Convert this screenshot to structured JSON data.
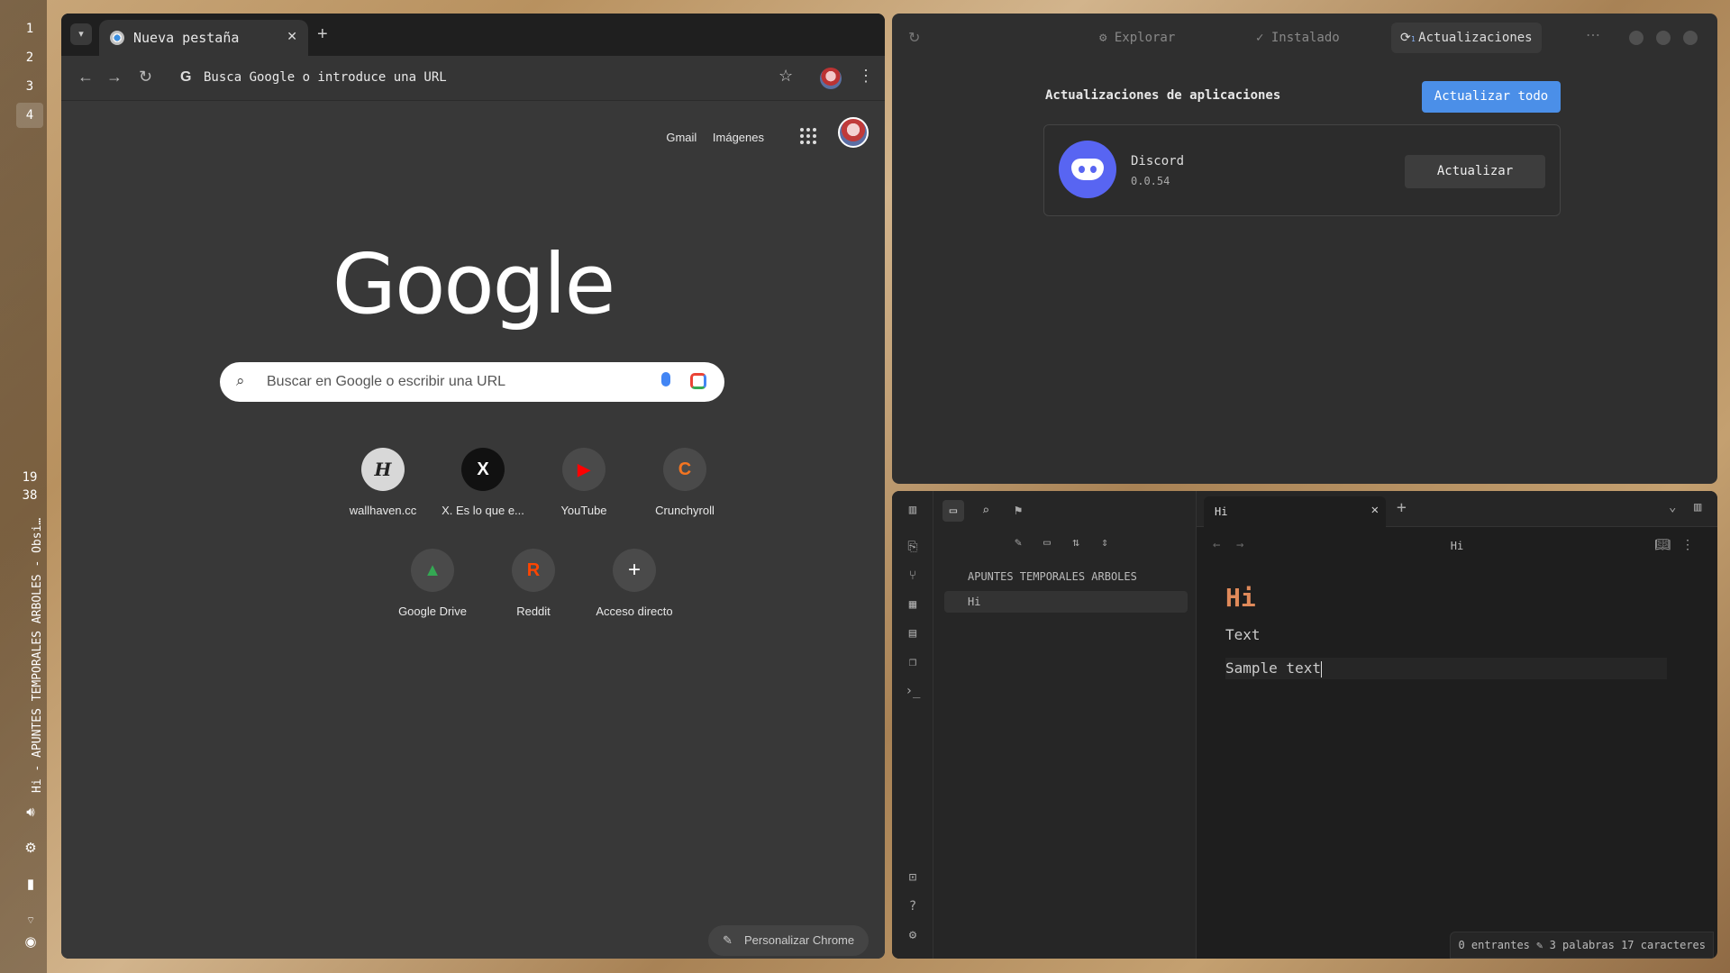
{
  "desktop": {
    "workspaces": [
      "1",
      "2",
      "3",
      "4"
    ],
    "active_workspace": "4",
    "clock": {
      "hour": "19",
      "minute": "38"
    },
    "window_title": "Hi - APUNTES TEMPORALES ARBOLES - Obsi…",
    "tray_icons": [
      "volume-icon",
      "settings-icon",
      "battery-icon",
      "wifi-icon",
      "discord-icon"
    ]
  },
  "chrome": {
    "tab_title": "Nueva pestaña",
    "address_placeholder": "Busca Google o introduce una URL",
    "top_links": [
      "Gmail",
      "Imágenes"
    ],
    "logo": "Google",
    "search_placeholder": "Buscar en Google o escribir una URL",
    "shortcuts": [
      {
        "label": "wallhaven.cc",
        "glyph": "H"
      },
      {
        "label": "X. Es lo que e...",
        "glyph": "X"
      },
      {
        "label": "YouTube",
        "glyph": "▶"
      },
      {
        "label": "Crunchyroll",
        "glyph": "C"
      },
      {
        "label": "Google Drive",
        "glyph": "▲"
      },
      {
        "label": "Reddit",
        "glyph": "R"
      },
      {
        "label": "Acceso directo",
        "glyph": "+"
      }
    ],
    "customize": "Personalizar Chrome"
  },
  "store": {
    "tabs": [
      "Explorar",
      "Instalado",
      "Actualizaciones"
    ],
    "active_tab": "Actualizaciones",
    "updates_badge": "1",
    "title": "Actualizaciones de aplicaciones",
    "update_all": "Actualizar todo",
    "apps": [
      {
        "name": "Discord",
        "version": "0.0.54",
        "action": "Actualizar"
      }
    ],
    "accent": "#4b8fe8"
  },
  "obsidian": {
    "vault": "APUNTES TEMPORALES ARBOLES",
    "files": [
      "Hi"
    ],
    "tab_title": "Hi",
    "view_title": "Hi",
    "note": {
      "heading": "Hi",
      "paragraph": "Text",
      "code": "Sample text"
    },
    "status": {
      "backlinks": "0 entrantes",
      "counts": "3 palabras 17 caracteres"
    },
    "heading_color": "#e08a5a"
  }
}
